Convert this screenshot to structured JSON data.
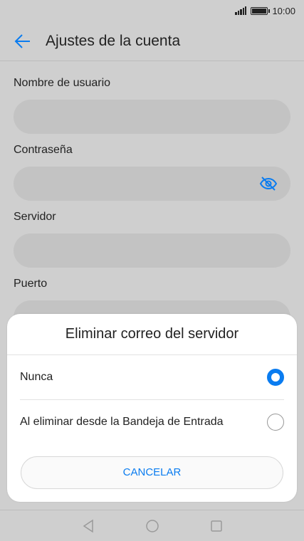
{
  "status_bar": {
    "time": "10:00"
  },
  "app_bar": {
    "title": "Ajustes de la cuenta"
  },
  "form": {
    "username_label": "Nombre de usuario",
    "password_label": "Contraseña",
    "server_label": "Servidor",
    "port_label": "Puerto"
  },
  "dialog": {
    "title": "Eliminar correo del servidor",
    "options": [
      {
        "label": "Nunca",
        "selected": true
      },
      {
        "label": "Al eliminar desde la Bandeja de Entrada",
        "selected": false
      }
    ],
    "cancel_label": "CANCELAR"
  },
  "colors": {
    "accent": "#0a7cf0"
  },
  "icons": {
    "back": "arrow-left-icon",
    "password_toggle": "eye-off-icon",
    "nav_back": "triangle-back-icon",
    "nav_home": "circle-home-icon",
    "nav_recents": "square-recents-icon"
  }
}
